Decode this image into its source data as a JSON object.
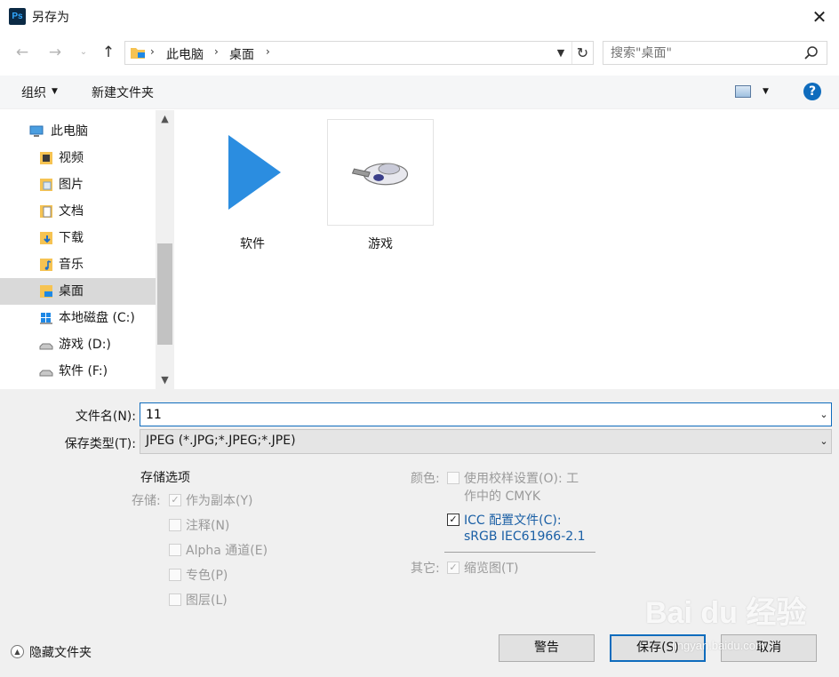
{
  "window": {
    "app_icon_label": "Ps",
    "title": "另存为",
    "close_glyph": "✕"
  },
  "address_bar": {
    "crumbs": [
      "此电脑",
      "桌面"
    ],
    "separator": "›",
    "search_placeholder": "搜索\"桌面\""
  },
  "toolbar": {
    "organize_label": "组织",
    "new_folder_label": "新建文件夹",
    "help_glyph": "?"
  },
  "nav": {
    "items": [
      {
        "label": "此电脑",
        "icon": "computer-icon"
      },
      {
        "label": "视频",
        "icon": "videos-folder-icon"
      },
      {
        "label": "图片",
        "icon": "pictures-folder-icon"
      },
      {
        "label": "文档",
        "icon": "documents-folder-icon"
      },
      {
        "label": "下载",
        "icon": "downloads-folder-icon"
      },
      {
        "label": "音乐",
        "icon": "music-folder-icon"
      },
      {
        "label": "桌面",
        "icon": "desktop-folder-icon",
        "selected": true
      },
      {
        "label": "本地磁盘 (C:)",
        "icon": "windows-drive-icon"
      },
      {
        "label": "游戏 (D:)",
        "icon": "drive-icon"
      },
      {
        "label": "软件 (F:)",
        "icon": "drive-icon"
      }
    ]
  },
  "files": [
    {
      "name": "软件",
      "icon": "play-arrow-shortcut-icon"
    },
    {
      "name": "游戏",
      "icon": "game-spaceship-icon"
    }
  ],
  "save_form": {
    "filename_label": "文件名(N):",
    "filename_value": "11",
    "filetype_label": "保存类型(T):",
    "filetype_value": "JPEG (*.JPG;*.JPEG;*.JPE)"
  },
  "options": {
    "heading": "存储选项",
    "storage_label": "存储:",
    "as_copy": "作为副本(Y)",
    "notes": "注释(N)",
    "alpha": "Alpha 通道(E)",
    "spot": "专色(P)",
    "layers": "图层(L)",
    "color_label": "颜色:",
    "proof_line1": "使用校样设置(O):  工",
    "proof_line2": "作中的 CMYK",
    "icc_line1": "ICC 配置文件(C):",
    "icc_line2": "sRGB IEC61966-2.1",
    "other_label": "其它:",
    "thumbnail": "缩览图(T)"
  },
  "footer": {
    "hide_folders": "隐藏文件夹",
    "warning_button": "警告",
    "save_button": "保存(S)",
    "cancel_button": "取消"
  },
  "watermark": {
    "brand": "Bai du 经验",
    "url": "jingyan.baidu.com"
  },
  "colors": {
    "accent": "#0f6cbd",
    "folder": "#f6c352",
    "play_arrow": "#2b8de0"
  }
}
